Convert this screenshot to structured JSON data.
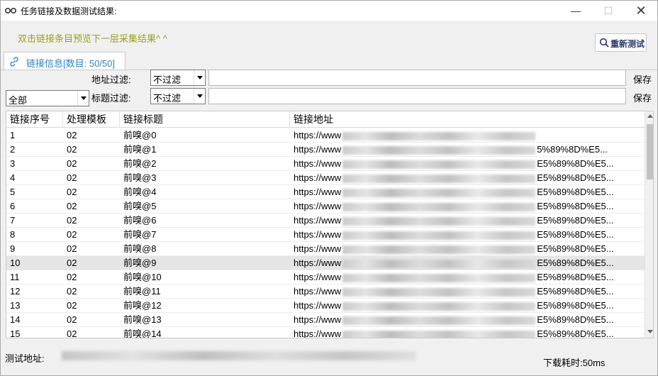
{
  "window": {
    "title": "任务链接及数据测试结果:"
  },
  "hint": "双击链接条目预览下一层采集结果^ ^",
  "toolbar": {
    "retest_label": "重新测试"
  },
  "tab": {
    "label": "链接信息[数目: 50/50]"
  },
  "filters": {
    "category_value": "全部",
    "address_label": "地址过滤:",
    "address_mode": "不过滤",
    "title_label": "标题过滤:",
    "title_mode": "不过滤",
    "save_label": "保存"
  },
  "grid": {
    "columns": [
      "链接序号",
      "处理模板",
      "链接标题",
      "链接地址"
    ],
    "selected_row": 9,
    "rows": [
      {
        "id": "1",
        "tpl": "02",
        "title": "前嗅@0",
        "url_prefix": "https://www",
        "url_suffix": ""
      },
      {
        "id": "2",
        "tpl": "02",
        "title": "前嗅@1",
        "url_prefix": "https://www",
        "url_suffix": "5%89%8D%E5..."
      },
      {
        "id": "3",
        "tpl": "02",
        "title": "前嗅@2",
        "url_prefix": "https://www",
        "url_suffix": "E5%89%8D%E5..."
      },
      {
        "id": "4",
        "tpl": "02",
        "title": "前嗅@3",
        "url_prefix": "https://www",
        "url_suffix": "E5%89%8D%E5..."
      },
      {
        "id": "5",
        "tpl": "02",
        "title": "前嗅@4",
        "url_prefix": "https://www",
        "url_suffix": "E5%89%8D%E5..."
      },
      {
        "id": "6",
        "tpl": "02",
        "title": "前嗅@5",
        "url_prefix": "https://www",
        "url_suffix": "E5%89%8D%E5..."
      },
      {
        "id": "7",
        "tpl": "02",
        "title": "前嗅@6",
        "url_prefix": "https://www",
        "url_suffix": "E5%89%8D%E5..."
      },
      {
        "id": "8",
        "tpl": "02",
        "title": "前嗅@7",
        "url_prefix": "https://www",
        "url_suffix": "E5%89%8D%E5..."
      },
      {
        "id": "9",
        "tpl": "02",
        "title": "前嗅@8",
        "url_prefix": "https://www",
        "url_suffix": "E5%89%8D%E5..."
      },
      {
        "id": "10",
        "tpl": "02",
        "title": "前嗅@9",
        "url_prefix": "https://www",
        "url_suffix": "E5%89%8D%E5..."
      },
      {
        "id": "11",
        "tpl": "02",
        "title": "前嗅@10",
        "url_prefix": "https://www",
        "url_suffix": "E5%89%8D%E5..."
      },
      {
        "id": "12",
        "tpl": "02",
        "title": "前嗅@11",
        "url_prefix": "https://www",
        "url_suffix": "E5%89%8D%E5..."
      },
      {
        "id": "13",
        "tpl": "02",
        "title": "前嗅@12",
        "url_prefix": "https://www",
        "url_suffix": "E5%89%8D%E5..."
      },
      {
        "id": "14",
        "tpl": "02",
        "title": "前嗅@13",
        "url_prefix": "https://www",
        "url_suffix": "E5%89%8D%E5..."
      },
      {
        "id": "15",
        "tpl": "02",
        "title": "前嗅@14",
        "url_prefix": "https://www",
        "url_suffix": "E5%89%8D%E5..."
      }
    ]
  },
  "status": {
    "test_url_label": "测试地址:",
    "download_time": "下载耗时:50ms"
  },
  "colors": {
    "hint": "#9aa31e",
    "tab_text": "#2e82c8",
    "selected_row": "#e5e5e5"
  }
}
